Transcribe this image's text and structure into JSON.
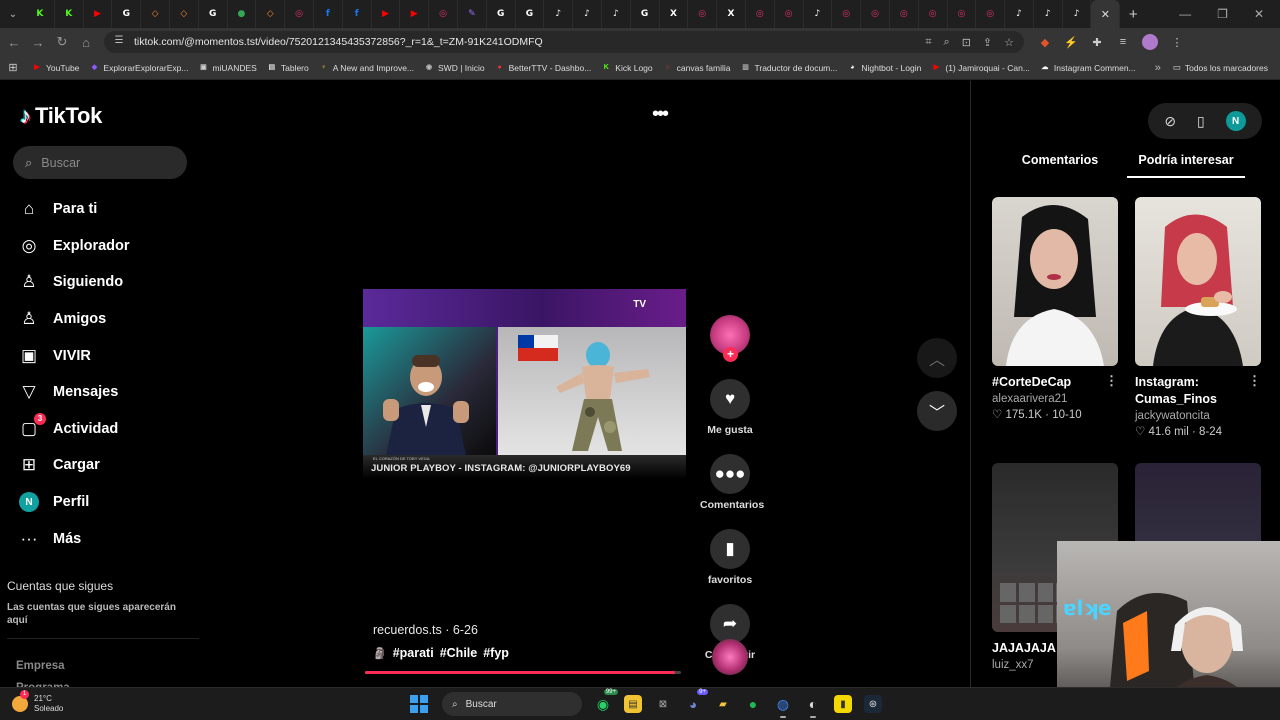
{
  "browser": {
    "url": "tiktok.com/@momentos.tst/video/7520121345435372856?_r=1&_t=ZM-91K241ODMFQ",
    "tabs": [
      {
        "icon": "kick-icon",
        "glyph": "K",
        "color": "#53fc18"
      },
      {
        "icon": "kick-icon",
        "glyph": "K",
        "color": "#53fc18"
      },
      {
        "icon": "youtube-icon",
        "glyph": "▶",
        "color": "#ff0000"
      },
      {
        "icon": "google-icon",
        "glyph": "G",
        "color": "#ffffff"
      },
      {
        "icon": "generic-icon",
        "glyph": "◇",
        "color": "#f28b30"
      },
      {
        "icon": "generic-icon",
        "glyph": "◇",
        "color": "#f28b30"
      },
      {
        "icon": "google-icon",
        "glyph": "G",
        "color": "#ffffff"
      },
      {
        "icon": "maps-icon",
        "glyph": "●",
        "color": "#34a853"
      },
      {
        "icon": "generic-icon",
        "glyph": "◇",
        "color": "#f28b30"
      },
      {
        "icon": "instagram-icon",
        "glyph": "◎",
        "color": "#e1306c"
      },
      {
        "icon": "facebook-icon",
        "glyph": "f",
        "color": "#1877f2"
      },
      {
        "icon": "facebook-icon",
        "glyph": "f",
        "color": "#1877f2"
      },
      {
        "icon": "youtube-icon",
        "glyph": "▶",
        "color": "#ff0000"
      },
      {
        "icon": "youtube-icon",
        "glyph": "▶",
        "color": "#ff0000"
      },
      {
        "icon": "instagram-icon",
        "glyph": "◎",
        "color": "#e1306c"
      },
      {
        "icon": "pen-icon",
        "glyph": "✎",
        "color": "#9b6cff"
      },
      {
        "icon": "google-icon",
        "glyph": "G",
        "color": "#ffffff"
      },
      {
        "icon": "google-icon",
        "glyph": "G",
        "color": "#ffffff"
      },
      {
        "icon": "tiktok-icon",
        "glyph": "♪",
        "color": "#ffffff"
      },
      {
        "icon": "tiktok-icon",
        "glyph": "♪",
        "color": "#ffffff"
      },
      {
        "icon": "tiktok-icon",
        "glyph": "♪",
        "color": "#ffffff"
      },
      {
        "icon": "google-icon",
        "glyph": "G",
        "color": "#ffffff"
      },
      {
        "icon": "x-icon",
        "glyph": "X",
        "color": "#ffffff"
      },
      {
        "icon": "instagram-icon",
        "glyph": "◎",
        "color": "#e1306c"
      },
      {
        "icon": "x-icon",
        "glyph": "X",
        "color": "#ffffff"
      },
      {
        "icon": "instagram-icon",
        "glyph": "◎",
        "color": "#e1306c"
      },
      {
        "icon": "instagram-icon",
        "glyph": "◎",
        "color": "#e1306c"
      },
      {
        "icon": "tiktok-icon",
        "glyph": "♪",
        "color": "#ffffff"
      },
      {
        "icon": "instagram-icon",
        "glyph": "◎",
        "color": "#e1306c"
      },
      {
        "icon": "instagram-icon",
        "glyph": "◎",
        "color": "#e1306c"
      },
      {
        "icon": "instagram-icon",
        "glyph": "◎",
        "color": "#e1306c"
      },
      {
        "icon": "instagram-icon",
        "glyph": "◎",
        "color": "#e1306c"
      },
      {
        "icon": "instagram-icon",
        "glyph": "◎",
        "color": "#e1306c"
      },
      {
        "icon": "instagram-icon",
        "glyph": "◎",
        "color": "#e1306c"
      },
      {
        "icon": "tiktok-icon",
        "glyph": "♪",
        "color": "#ffffff"
      },
      {
        "icon": "tiktok-icon",
        "glyph": "♪",
        "color": "#ffffff"
      },
      {
        "icon": "tiktok-icon",
        "glyph": "♪",
        "color": "#ffffff"
      },
      {
        "icon": "close-icon",
        "glyph": "✕",
        "color": "#dddddd",
        "active": true
      }
    ],
    "bookmarks": [
      {
        "label": "YouTube",
        "glyph": "▶",
        "color": "#ff0000"
      },
      {
        "label": "ExplorarExplorarExp...",
        "glyph": "◆",
        "color": "#8a5cff"
      },
      {
        "label": "miUANDES",
        "glyph": "▣",
        "color": "#cccccc"
      },
      {
        "label": "Tablero",
        "glyph": "▤",
        "color": "#dddddd"
      },
      {
        "label": "A New and Improve...",
        "glyph": "♀",
        "color": "#f5c518"
      },
      {
        "label": "SWD | Inicio",
        "glyph": "◉",
        "color": "#bbbbbb"
      },
      {
        "label": "BetterTTV - Dashbo...",
        "glyph": "●",
        "color": "#e33"
      },
      {
        "label": "Kick Logo",
        "glyph": "K",
        "color": "#53fc18"
      },
      {
        "label": "canvas familia",
        "glyph": "○",
        "color": "#e33"
      },
      {
        "label": "Traductor de docum...",
        "glyph": "▥",
        "color": "#aaaaaa"
      },
      {
        "label": "Nightbot - Login",
        "glyph": "◕",
        "color": "#ffffff"
      },
      {
        "label": "(1) Jamiroquai - Can...",
        "glyph": "▶",
        "color": "#ff0000"
      },
      {
        "label": "Instagram Commen...",
        "glyph": "☁",
        "color": "#ffffff"
      }
    ],
    "bookmarks_folder": "Todos los marcadores"
  },
  "tiktok": {
    "brand": "TikTok",
    "search_placeholder": "Buscar",
    "nav": [
      {
        "label": "Para ti",
        "icon": "home-icon",
        "glyph": "⌂"
      },
      {
        "label": "Explorador",
        "icon": "compass-icon",
        "glyph": "◎"
      },
      {
        "label": "Siguiendo",
        "icon": "user-follow-icon",
        "glyph": "♙"
      },
      {
        "label": "Amigos",
        "icon": "friends-icon",
        "glyph": "♙"
      },
      {
        "label": "VIVIR",
        "icon": "live-icon",
        "glyph": "▣"
      },
      {
        "label": "Mensajes",
        "icon": "messages-icon",
        "glyph": "▽"
      },
      {
        "label": "Actividad",
        "icon": "activity-icon",
        "glyph": "▢",
        "badge": "3"
      },
      {
        "label": "Cargar",
        "icon": "upload-icon",
        "glyph": "⊞"
      },
      {
        "label": "Perfil",
        "icon": "profile-avatar",
        "glyph": "N"
      },
      {
        "label": "Más",
        "icon": "more-icon",
        "glyph": "···"
      }
    ],
    "following_title": "Cuentas que sigues",
    "following_desc": "Las cuentas que sigues aparecerán aquí",
    "footer": [
      "Empresa",
      "Programa"
    ],
    "video": {
      "caption": "JUNIOR PLAYBOY - INSTAGRAM: @JUNIORPLAYBOY69",
      "caption_small": "EL CORAZÓN DE TOBY VEGA",
      "author": "recuerdos.ts",
      "date": "6-26",
      "tags": [
        "#parati",
        "#Chile",
        "#fyp"
      ],
      "progress": 0.98
    },
    "actions": {
      "like": "Me gusta",
      "comments": "Comentarios",
      "favorites": "favoritos",
      "share": "Compartir"
    },
    "side_panel": {
      "avatar_letter": "N",
      "tab_comments": "Comentarios",
      "tab_suggested": "Podría interesar",
      "cards": [
        {
          "title": "#CorteDeCap",
          "user": "alexaarivera21",
          "likes": "175.1K",
          "date": "10-10"
        },
        {
          "title": "Instagram: Cumas_Finos",
          "user": "jackywatoncita",
          "likes": "41.6 mil",
          "date": "8-24"
        },
        {
          "title": "JAJAJAJA",
          "user": "luiz_xx7",
          "likes": "",
          "date": ""
        },
        {
          "title": "",
          "user": "",
          "likes": "",
          "date": ""
        }
      ]
    }
  },
  "taskbar": {
    "temp": "21°C",
    "condition": "Soleado",
    "weather_badge": "1",
    "search": "Buscar",
    "whatsapp_badge": "99+",
    "discord_badge": "9+"
  }
}
